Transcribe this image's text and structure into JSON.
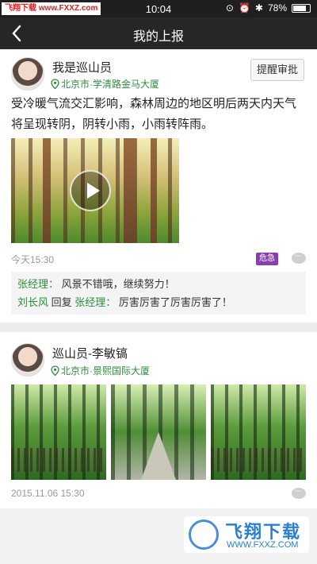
{
  "status_bar": {
    "watermark": "飞翔下载 www.FXXZ.com",
    "time": "10:04",
    "battery": "78%",
    "battery_level": 0.78
  },
  "nav": {
    "title": "我的上报"
  },
  "posts": [
    {
      "author": "我是巡山员",
      "location": "北京市·学清路金马大厦",
      "action_button": "提醒审批",
      "content": "受冷暖气流交汇影响，森林周边的地区明后两天内天气将呈现转阴，阴转小雨，小雨转阵雨。",
      "time": "今天15:30",
      "badge": "危急",
      "comments": [
        {
          "name": "张经理：",
          "text": "风景不错哦，继续努力！"
        },
        {
          "name": "刘长风",
          "reply_word": "回复",
          "target": "张经理：",
          "text": "厉害厉害了厉害厉害了！"
        }
      ]
    },
    {
      "author": "巡山员-李敏镐",
      "location": "北京市·景熙国际大厦",
      "time": "2015.11.06  15:30"
    }
  ],
  "watermark_logo": {
    "brand": "飞翔下载",
    "url": "WWW.FXXZ.COM"
  }
}
